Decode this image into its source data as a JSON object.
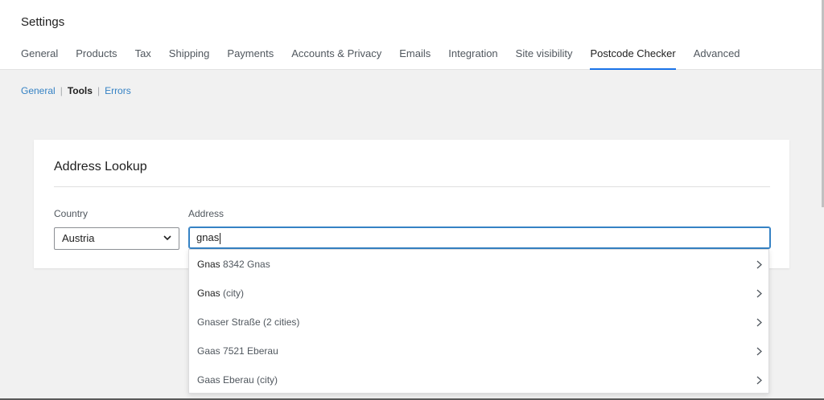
{
  "header": {
    "title": "Settings",
    "tabs": [
      {
        "label": "General"
      },
      {
        "label": "Products"
      },
      {
        "label": "Tax"
      },
      {
        "label": "Shipping"
      },
      {
        "label": "Payments"
      },
      {
        "label": "Accounts & Privacy"
      },
      {
        "label": "Emails"
      },
      {
        "label": "Integration"
      },
      {
        "label": "Site visibility"
      },
      {
        "label": "Postcode Checker",
        "active": true
      },
      {
        "label": "Advanced"
      }
    ]
  },
  "subnav": {
    "general": "General",
    "tools": "Tools",
    "errors": "Errors",
    "separator": "|"
  },
  "card": {
    "title": "Address Lookup",
    "country_label": "Country",
    "country_value": "Austria",
    "address_label": "Address",
    "address_value": "gnas"
  },
  "suggestions": [
    {
      "bold": "Gnas",
      "rest": " 8342 Gnas"
    },
    {
      "bold": "Gnas",
      "rest": " (city)"
    },
    {
      "bold": "",
      "rest": "Gnaser Straße (2 cities)"
    },
    {
      "bold": "",
      "rest": "Gaas 7521 Eberau"
    },
    {
      "bold": "",
      "rest": "Gaas Eberau (city)"
    }
  ],
  "colors": {
    "accent": "#1a73e8",
    "link": "#3582c4",
    "focus_border": "#3582c4"
  },
  "icons": {
    "select": "chevron-down-icon",
    "suggestion": "chevron-right-icon"
  }
}
